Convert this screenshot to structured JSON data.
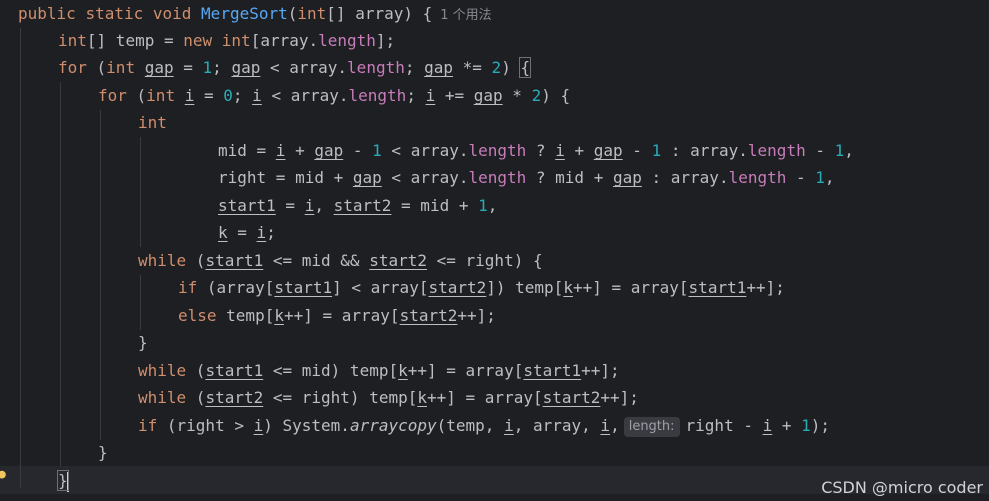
{
  "editor": {
    "usages_hint": "1 个用法",
    "param_hint": "length:",
    "watermark": "CSDN @micro coder"
  },
  "colors": {
    "background": "#1e1f22",
    "keyword": "#cf8e6d",
    "method": "#56a8f5",
    "number": "#2aacb8",
    "field": "#c77dbb",
    "text": "#bcbec4"
  },
  "tokens": {
    "public": "public",
    "static": "static",
    "void": "void",
    "method_name": "MergeSort",
    "paren_open": "(",
    "int_kw": "int",
    "array_param": "[] array) {",
    "int_arr": "int",
    "temp_decl": "[] temp = ",
    "new_kw": "new",
    "int_kw2": "int",
    "array_dot": "[array.",
    "length": "length",
    "close_semi": "];",
    "for_kw": "for",
    "for_open": " (",
    "int_kw3": "int",
    "gap": "gap",
    "eq": " = ",
    "one": "1",
    "semi": "; ",
    "lt_array": " < array.",
    "times_eq": " *= ",
    "two": "2",
    "close_paren": ") ",
    "brace_open": "{",
    "for_kw2": "for",
    "int_kw4": "int",
    "i": "i",
    "zero": "0",
    "plus_eq": " += ",
    "times": " * ",
    "close_paren_brace": ") {",
    "int_kw5": "int",
    "mid_eq": "mid = ",
    "plus": " + ",
    "minus": " - ",
    "q": " ? ",
    "colon_array": " : array.",
    "comma": ",",
    "right_eq": "right = mid + ",
    "mid_q": " ? mid + ",
    "start1": "start1",
    "start2": "start2",
    "comma_sp": ", ",
    "eq_mid_plus": " = mid + ",
    "k": "k",
    "eq2": " = ",
    "semi_end": ";",
    "while_kw": "while",
    "open": " (",
    "le_mid_and": " <= mid && ",
    "le_right": " <= right) {",
    "if_kw": "if",
    "array_open": " (array[",
    "lt_array2": "] < array[",
    "temp_open": "]) temp[",
    "pp_eq_array": "++] = array[",
    "pp_end": "++];",
    "else_kw": "else",
    "temp_sp": " temp[",
    "close_brace": "}",
    "le_mid": " <= mid) temp[",
    "le_right2": " <= right) temp[",
    "right_gt": " (right > ",
    "system": ") System.",
    "arraycopy": "arraycopy",
    "temp_comma": "(temp, ",
    "comma_array": ", array, ",
    "comma_only": ",",
    "right_minus": "right - ",
    "close_all": ");"
  }
}
